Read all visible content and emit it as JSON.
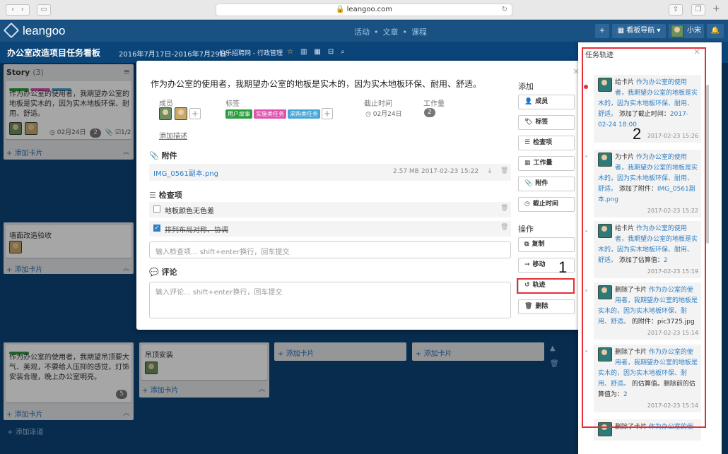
{
  "browser": {
    "url": "leangoo.com"
  },
  "app": {
    "logo": "leangoo",
    "nav": [
      "活动",
      "文章",
      "课程"
    ],
    "kanban_nav": "看板导航",
    "user": "小宋"
  },
  "board": {
    "title": "办公室改造项目任务看板",
    "dates": "2016年7月17日-2016年7月29日",
    "team": "伯乐招聘网 - 行政管理"
  },
  "columns": {
    "story": {
      "title": "Story",
      "count": "(3)",
      "card1": {
        "text": "作为办公室的使用者，我期望办公室的地板是实木的，因为实木地板环保、耐用、舒适。",
        "date": "02月24日",
        "badge": "2",
        "check": "1/2"
      },
      "add": "添加卡片"
    },
    "wall": {
      "card": "墙面改造验收",
      "add": "添加卡片"
    },
    "story3": {
      "text": "作为办公室的使用者，我期望吊顶要大气、美观，不要给人压抑的感觉，灯饰安装合理，晚上办公室明亮。",
      "badge": "5",
      "add": "添加卡片"
    },
    "ceiling": {
      "card": "吊顶安装",
      "add": "添加卡片"
    },
    "c3": {
      "add": "添加卡片"
    },
    "c4": {
      "add": "添加卡片"
    },
    "lane": {
      "add": "添加泳道"
    }
  },
  "modal": {
    "title": "作为办公室的使用者，我期望办公室的地板是实木的，因为实木地板环保、耐用、舒适。",
    "labels": {
      "members": "成员",
      "tags": "标签",
      "due": "截止时间",
      "workload": "工作量"
    },
    "tags": [
      "用户故事",
      "实施类任务",
      "采购类任务"
    ],
    "due": "02月24日",
    "workload": "2",
    "add_desc": "添加描述",
    "attach_title": "附件",
    "attachment": {
      "name": "IMG_0561副本.png",
      "size": "2.57 MB",
      "time": "2017-02-23 15:22"
    },
    "checklist_title": "检查项",
    "checklist": [
      {
        "text": "地板颜色无色差",
        "done": false
      },
      {
        "text": "排列布局对称、协调",
        "done": true
      }
    ],
    "check_placeholder": "输入检查项... shift+enter换行，回车提交",
    "comment_title": "评论",
    "comment_placeholder": "输入评论... shift+enter换行，回车提交",
    "side": {
      "add_title": "添加",
      "add": [
        "成员",
        "标签",
        "检查项",
        "工作量",
        "附件",
        "截止时间"
      ],
      "op_title": "操作",
      "ops": [
        "复制",
        "移动",
        "轨迹",
        "删除"
      ]
    }
  },
  "history": {
    "title": "任务轨迹",
    "items": [
      {
        "pre": "给卡片 ",
        "link": "作为办公室的使用者，我期望办公室的地板是实木的，因为实木地板环保、耐用、舒适。",
        "mid": " 添加了截止时间：",
        "val": "2017-02-24 18:00",
        "time": "2017-02-23 15:26"
      },
      {
        "pre": "为卡片 ",
        "link": "作为办公室的使用者，我期望办公室的地板是实木的，因为实木地板环保、耐用、舒适。",
        "mid": " 添加了附件：",
        "val": "IMG_0561副本.png",
        "time": "2017-02-23 15:22"
      },
      {
        "pre": "给卡片 ",
        "link": "作为办公室的使用者，我期望办公室的地板是实木的，因为实木地板环保、耐用、舒适。",
        "mid": " 添加了估算值：",
        "val": "2",
        "time": "2017-02-23 15:19"
      },
      {
        "pre": "删除了卡片 ",
        "link": "作为办公室的使用者，我期望办公室的地板是实木的，因为实木地板环保、耐用、舒适。",
        "mid": " 的附件：pic3725.jpg",
        "val": "",
        "time": "2017-02-23 15:14"
      },
      {
        "pre": "删除了卡片 ",
        "link": "作为办公室的使用者，我期望办公室的地板是实木的，因为实木地板环保、耐用、舒适。",
        "mid": " 的估算值。删除前的估算值为：",
        "val": "2",
        "time": "2017-02-23 15:14"
      },
      {
        "pre": "删除了卡片 ",
        "link": "作为办公室的使",
        "mid": "",
        "val": "",
        "time": ""
      }
    ]
  },
  "annotations": [
    "1",
    "2"
  ]
}
